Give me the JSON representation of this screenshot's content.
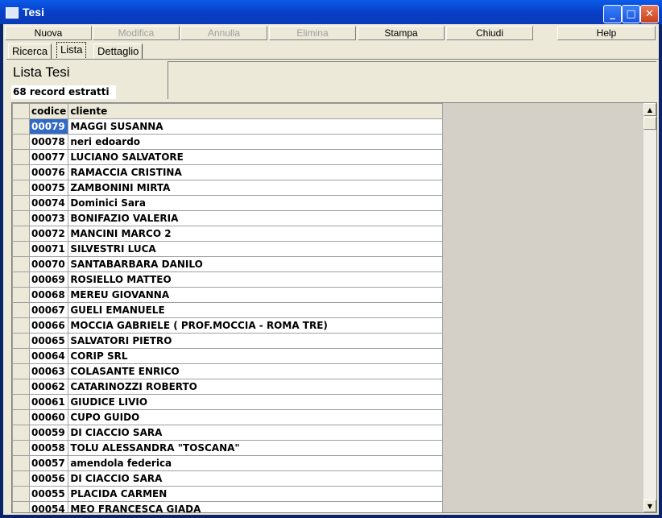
{
  "window": {
    "title": "Tesi",
    "minimize": "_",
    "maximize": "□",
    "close": "✕"
  },
  "menu": [
    {
      "label": "Nuova",
      "enabled": true
    },
    {
      "label": "Modifica",
      "enabled": false
    },
    {
      "label": "Annulla",
      "enabled": false
    },
    {
      "label": "Elimina",
      "enabled": false
    },
    {
      "label": "Stampa",
      "enabled": true
    },
    {
      "label": "Chiudi",
      "enabled": true
    },
    {
      "label": "Help",
      "enabled": true
    }
  ],
  "tabs": [
    "Ricerca",
    "Lista",
    "Dettaglio"
  ],
  "heading": "Lista Tesi",
  "count_label": "68 record estratti",
  "table": {
    "headers": [
      "codice",
      "cliente"
    ],
    "rows": [
      [
        "00079",
        "MAGGI SUSANNA"
      ],
      [
        "00078",
        "neri edoardo"
      ],
      [
        "00077",
        "LUCIANO SALVATORE"
      ],
      [
        "00076",
        "RAMACCIA CRISTINA"
      ],
      [
        "00075",
        "ZAMBONINI MIRTA"
      ],
      [
        "00074",
        "Dominici Sara"
      ],
      [
        "00073",
        "BONIFAZIO VALERIA"
      ],
      [
        "00072",
        "MANCINI MARCO 2"
      ],
      [
        "00071",
        "SILVESTRI LUCA"
      ],
      [
        "00070",
        "SANTABARBARA DANILO"
      ],
      [
        "00069",
        "ROSIELLO MATTEO"
      ],
      [
        "00068",
        "MEREU GIOVANNA"
      ],
      [
        "00067",
        "GUELI EMANUELE"
      ],
      [
        "00066",
        "MOCCIA GABRIELE ( PROF.MOCCIA - ROMA TRE)"
      ],
      [
        "00065",
        "SALVATORI PIETRO"
      ],
      [
        "00064",
        "CORIP SRL"
      ],
      [
        "00063",
        "COLASANTE ENRICO"
      ],
      [
        "00062",
        "CATARINOZZI ROBERTO"
      ],
      [
        "00061",
        "GIUDICE LIVIO"
      ],
      [
        "00060",
        "CUPO GUIDO"
      ],
      [
        "00059",
        "DI CIACCIO SARA"
      ],
      [
        "00058",
        "TOLU ALESSANDRA \"TOSCANA\""
      ],
      [
        "00057",
        "amendola federica"
      ],
      [
        "00056",
        "DI CIACCIO SARA"
      ],
      [
        "00055",
        "PLACIDA CARMEN"
      ],
      [
        "00054",
        "MEO FRANCESCA GIADA"
      ]
    ]
  }
}
